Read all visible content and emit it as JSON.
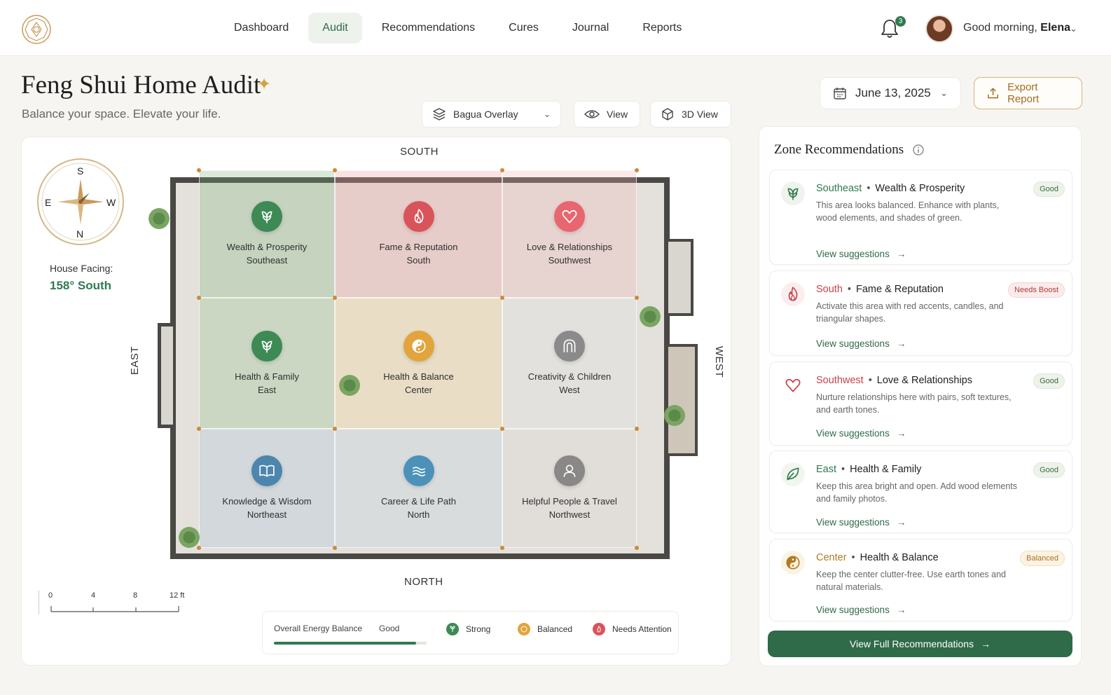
{
  "nav": {
    "items": [
      {
        "label": "Dashboard",
        "active": false
      },
      {
        "label": "Audit",
        "active": true
      },
      {
        "label": "Recommendations",
        "active": false
      },
      {
        "label": "Cures",
        "active": false
      },
      {
        "label": "Journal",
        "active": false
      },
      {
        "label": "Reports",
        "active": false
      }
    ],
    "notification_count": "3",
    "greeting_prefix": "Good morning,",
    "user_name": "Elena"
  },
  "page": {
    "title": "Feng Shui Home Audit",
    "subtitle": "Balance your space. Elevate your life."
  },
  "toolbar": {
    "overlay_label": "Bagua Overlay",
    "view_label": "View",
    "view3d_label": "3D View",
    "date_label": "June 13, 2025",
    "export_label": "Export Report"
  },
  "compass": {
    "s": "S",
    "e": "E",
    "w": "W",
    "n": "N",
    "facing_label": "House Facing:",
    "facing_value": "158° South"
  },
  "plan": {
    "south_label": "SOUTH",
    "north_label": "NORTH",
    "east_label": "EAST",
    "west_label": "WEST",
    "zones": [
      {
        "name": "Wealth & Prosperity",
        "dir": "Southeast",
        "icon": "plant-icon",
        "color": "#3d8a54",
        "tint": "rgba(120,175,120,0.28)"
      },
      {
        "name": "Fame & Reputation",
        "dir": "South",
        "icon": "flame-icon",
        "color": "#d9545a",
        "tint": "rgba(240,160,160,0.30)"
      },
      {
        "name": "Love & Relationships",
        "dir": "Southwest",
        "icon": "heart-icon",
        "color": "#e8666f",
        "tint": "rgba(240,175,180,0.28)"
      },
      {
        "name": "Health & Family",
        "dir": "East",
        "icon": "plant-icon",
        "color": "#3d8a54",
        "tint": "rgba(140,190,130,0.28)"
      },
      {
        "name": "Health & Balance",
        "dir": "Center",
        "icon": "yin-yang-icon",
        "color": "#e2a43c",
        "tint": "rgba(245,215,150,0.32)"
      },
      {
        "name": "Creativity & Children",
        "dir": "West",
        "icon": "arch-icon",
        "color": "#8a8a8a",
        "tint": "rgba(225,225,225,0.35)"
      },
      {
        "name": "Knowledge & Wisdom",
        "dir": "Northeast",
        "icon": "book-icon",
        "color": "#4c86ad",
        "tint": "rgba(170,195,220,0.30)"
      },
      {
        "name": "Career & Life Path",
        "dir": "North",
        "icon": "water-icon",
        "color": "#4c92b8",
        "tint": "rgba(190,210,225,0.30)"
      },
      {
        "name": "Helpful People & Travel",
        "dir": "Northwest",
        "icon": "person-icon",
        "color": "#8a8886",
        "tint": "rgba(220,218,215,0.35)"
      }
    ],
    "scale": {
      "t0": "0",
      "t1": "4",
      "t2": "8",
      "t3": "12 ft"
    }
  },
  "legend": {
    "title": "Overall Energy Balance",
    "value": "Good",
    "progress": 0.93,
    "strong": "Strong",
    "balanced": "Balanced",
    "attention": "Needs Attention",
    "colors": {
      "strong": "#3d8a54",
      "balanced": "#e2a43c",
      "attention": "#d9545a"
    }
  },
  "recs": {
    "title": "Zone Recommendations",
    "link_label": "View suggestions",
    "cards": [
      {
        "dir": "Southeast",
        "area": "Wealth & Prosperity",
        "desc": "This area looks balanced. Enhance with plants, wood elements, and shades of green.",
        "badge": "Good",
        "badge_type": "good",
        "icon": "plant-icon",
        "dir_color": "#2f7a4f"
      },
      {
        "dir": "South",
        "area": "Fame & Reputation",
        "desc": "Activate this area with red accents, candles, and triangular shapes.",
        "badge": "Needs Boost",
        "badge_type": "boost",
        "icon": "flame-icon",
        "dir_color": "#c8414a"
      },
      {
        "dir": "Southwest",
        "area": "Love & Relationships",
        "desc": "Nurture relationships here with pairs, soft textures, and earth tones.",
        "badge": "Good",
        "badge_type": "good",
        "icon": "heart-icon",
        "dir_color": "#c8414a"
      },
      {
        "dir": "East",
        "area": "Health & Family",
        "desc": "Keep this area bright and open. Add wood elements and family photos.",
        "badge": "Good",
        "badge_type": "good",
        "icon": "leaf-icon",
        "dir_color": "#2f7a4f"
      },
      {
        "dir": "Center",
        "area": "Health & Balance",
        "desc": "Keep the center clutter-free. Use earth tones and natural materials.",
        "badge": "Balanced",
        "badge_type": "balanced",
        "icon": "yin-yang-icon",
        "dir_color": "#b27a22"
      }
    ],
    "full_button": "View Full Recommendations"
  }
}
